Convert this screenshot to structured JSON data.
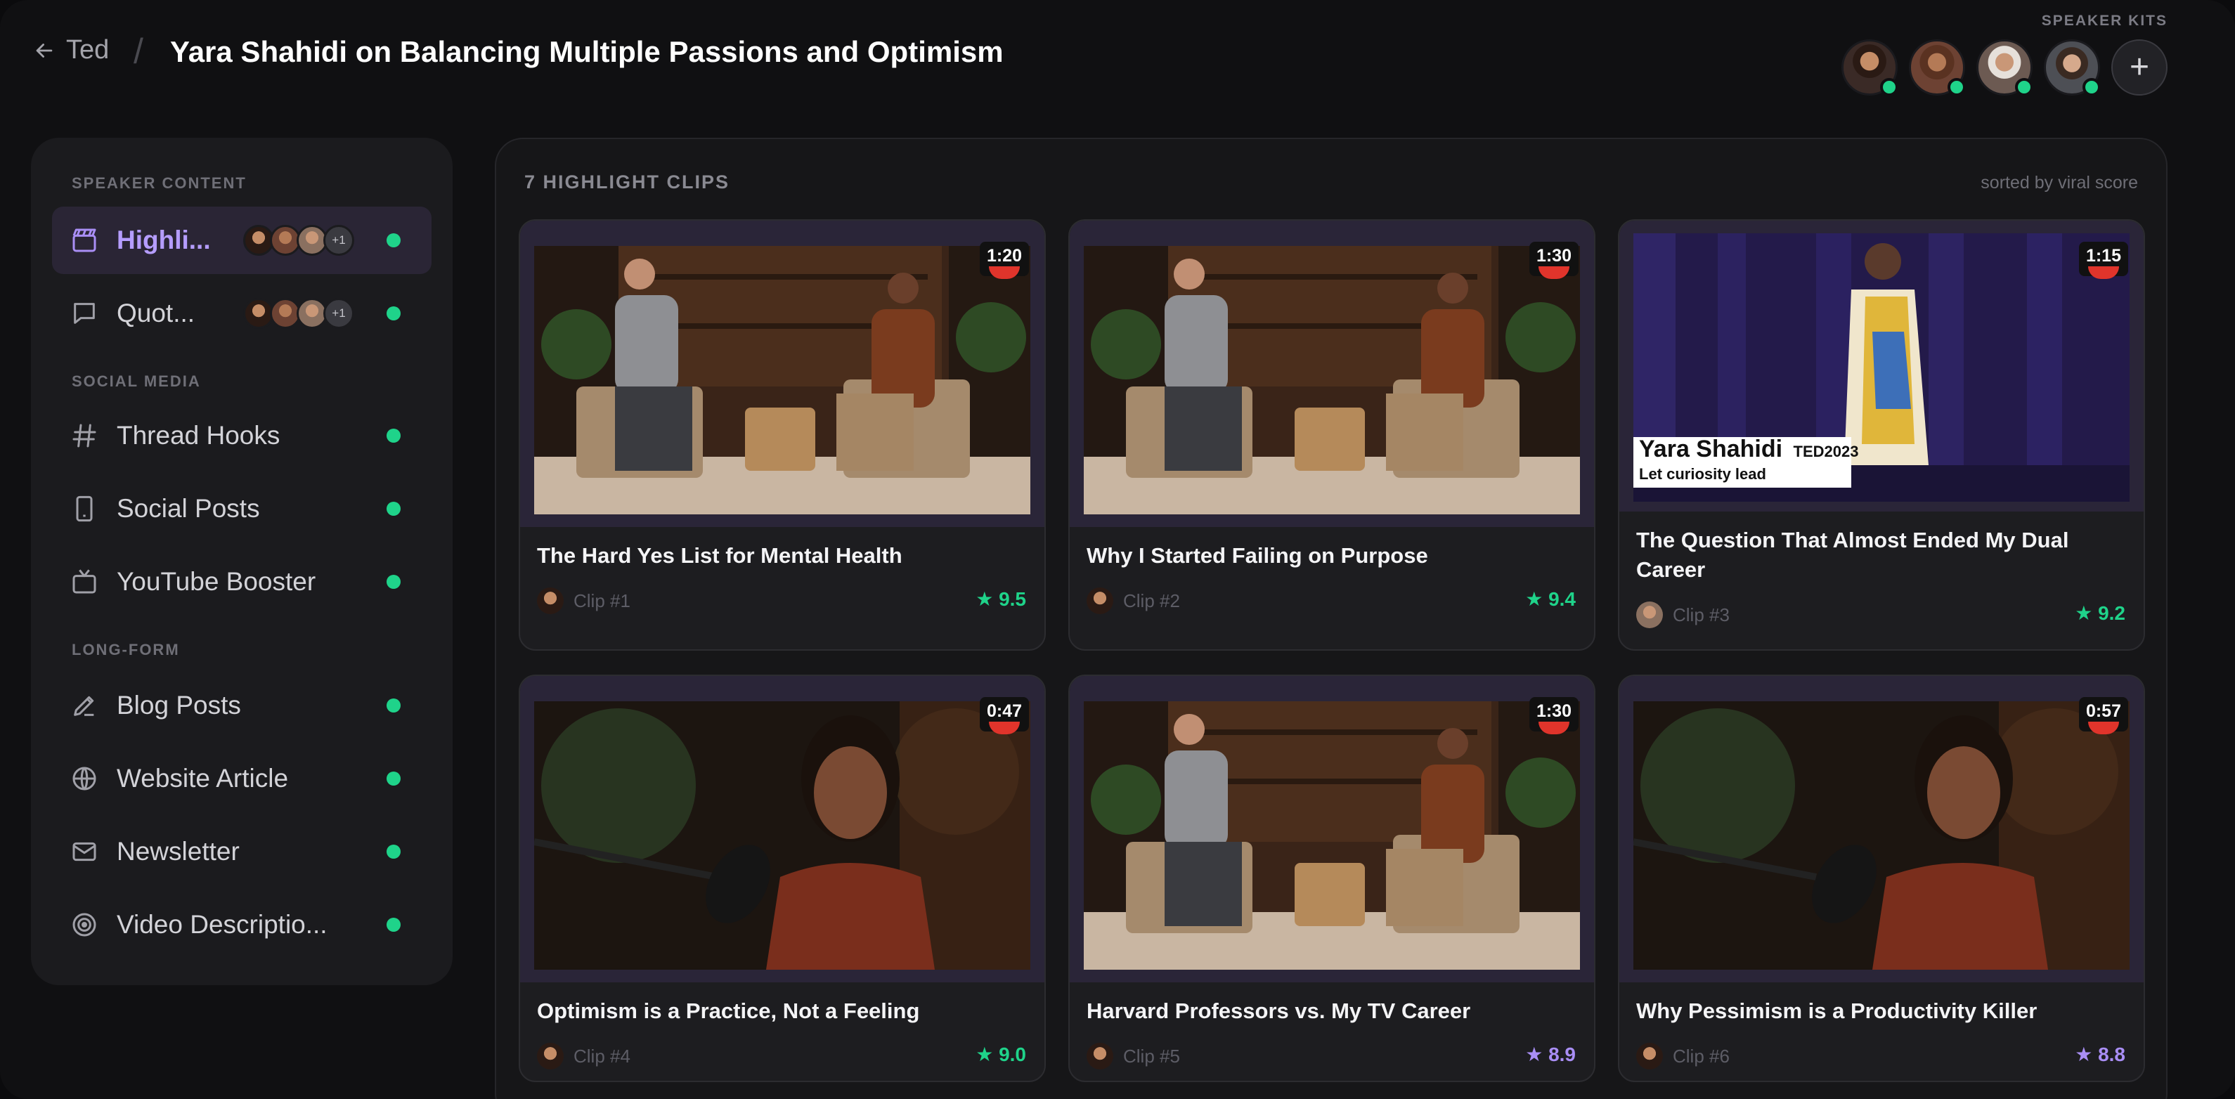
{
  "header": {
    "back_label": "Ted",
    "title": "Yara Shahidi on Balancing Multiple Passions and Optimism",
    "kits_label": "SPEAKER KITS",
    "add_label": "+"
  },
  "sidebar": {
    "sections": [
      {
        "label": "SPEAKER CONTENT"
      },
      {
        "label": "SOCIAL MEDIA"
      },
      {
        "label": "LONG-FORM"
      }
    ],
    "items": [
      {
        "label": "Highli...",
        "icon": "clapperboard-icon",
        "active": true,
        "more": "+1"
      },
      {
        "label": "Quot...",
        "icon": "speech-bubble-icon",
        "more": "+1"
      },
      {
        "label": "Thread Hooks",
        "icon": "hashtag-icon"
      },
      {
        "label": "Social Posts",
        "icon": "phone-icon"
      },
      {
        "label": "YouTube Booster",
        "icon": "tv-icon"
      },
      {
        "label": "Blog Posts",
        "icon": "pen-icon"
      },
      {
        "label": "Website Article",
        "icon": "globe-icon"
      },
      {
        "label": "Newsletter",
        "icon": "mail-icon"
      },
      {
        "label": "Video Descriptio...",
        "icon": "target-icon"
      }
    ]
  },
  "main": {
    "count_label": "7 HIGHLIGHT CLIPS",
    "sort_label": "sorted by viral score",
    "clips": [
      {
        "title": "The Hard Yes List for Mental Health",
        "clip": "Clip #1",
        "duration": "1:20",
        "score": "★ 9.5",
        "scene": "studio-two-people"
      },
      {
        "title": "Why I Started Failing on Purpose",
        "clip": "Clip #2",
        "duration": "1:30",
        "score": "★ 9.4",
        "scene": "studio-two-people"
      },
      {
        "title": "The Question That Almost Ended My Dual Career",
        "clip": "Clip #3",
        "duration": "1:15",
        "score": "★ 9.2",
        "scene": "ted-stage",
        "lower_third_name": "Yara Shahidi",
        "lower_third_event": "TED2023",
        "lower_third_tagline": "Let curiosity lead"
      },
      {
        "title": "Optimism is a Practice, Not a Feeling",
        "clip": "Clip #4",
        "duration": "0:47",
        "score": "★ 9.0",
        "scene": "podcast-closeup"
      },
      {
        "title": "Harvard Professors vs. My TV Career",
        "clip": "Clip #5",
        "duration": "1:30",
        "score": "★ 8.9",
        "scene": "studio-two-people"
      },
      {
        "title": "Why Pessimism is a Productivity Killer",
        "clip": "Clip #6",
        "duration": "0:57",
        "score": "★ 8.8",
        "scene": "podcast-closeup"
      }
    ]
  },
  "colors": {
    "accent_purple": "#a98ef5",
    "status_green": "#1fd38a",
    "duration_red": "#e0342b"
  }
}
